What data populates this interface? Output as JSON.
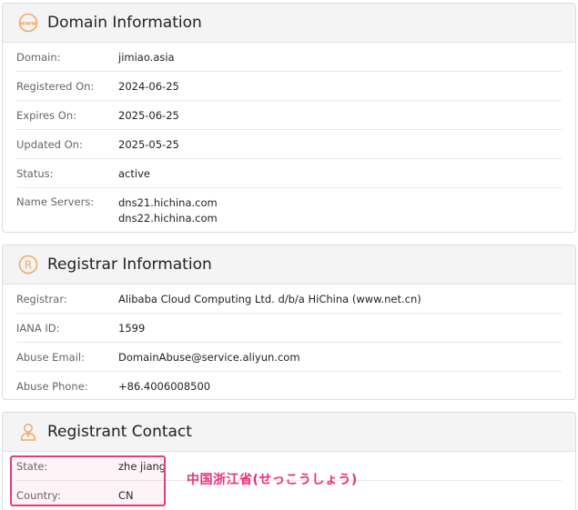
{
  "domain_info": {
    "title": "Domain Information",
    "icon": "www-globe-icon",
    "rows": [
      {
        "label": "Domain:",
        "value": "jimiao.asia"
      },
      {
        "label": "Registered On:",
        "value": "2024-06-25"
      },
      {
        "label": "Expires On:",
        "value": "2025-06-25"
      },
      {
        "label": "Updated On:",
        "value": "2025-05-25"
      },
      {
        "label": "Status:",
        "value": "active"
      }
    ],
    "name_servers": {
      "label": "Name Servers:",
      "values": [
        "dns21.hichina.com",
        "dns22.hichina.com"
      ]
    }
  },
  "registrar_info": {
    "title": "Registrar Information",
    "icon": "registered-icon",
    "rows": [
      {
        "label": "Registrar:",
        "value": "Alibaba Cloud Computing Ltd. d/b/a HiChina (www.net.cn)"
      },
      {
        "label": "IANA ID:",
        "value": "1599"
      },
      {
        "label": "Abuse Email:",
        "value": "DomainAbuse@service.aliyun.com"
      },
      {
        "label": "Abuse Phone:",
        "value": "+86.4006008500"
      }
    ]
  },
  "registrant_contact": {
    "title": "Registrant Contact",
    "icon": "person-icon",
    "rows": [
      {
        "label": "State:",
        "value": "zhe jiang"
      },
      {
        "label": "Country:",
        "value": "CN"
      }
    ]
  },
  "annotation": {
    "text": "中国浙江省(せっこうしょう)",
    "color": "#e8317a"
  },
  "colors": {
    "accent_icon": "#f0a868",
    "highlight": "#e83b7b"
  }
}
